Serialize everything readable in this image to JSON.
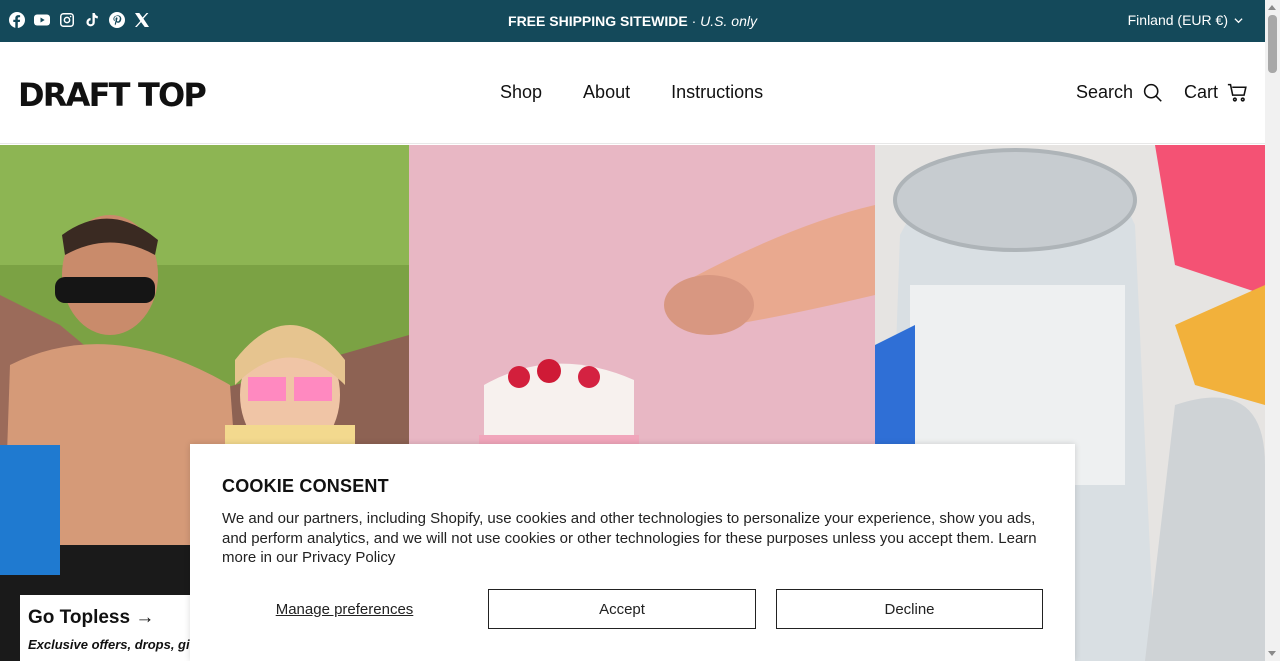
{
  "announcement": {
    "bold": "FREE SHIPPING SITEWIDE",
    "separator": " · ",
    "italic": "U.S. only"
  },
  "socials": [
    "facebook-icon",
    "youtube-icon",
    "instagram-icon",
    "tiktok-icon",
    "pinterest-icon",
    "x-icon"
  ],
  "region": "Finland (EUR €)",
  "header": {
    "logo": "DRAFT TOP",
    "nav": [
      "Shop",
      "About",
      "Instructions"
    ],
    "search": "Search",
    "cart": "Cart"
  },
  "promo": {
    "title": "Go Topless →",
    "subtitle": "Exclusive offers, drops, giv"
  },
  "cookie": {
    "title": "COOKIE CONSENT",
    "text": "We and our partners, including Shopify, use cookies and other technologies to personalize your experience, show you ads, and perform analytics, and we will not use cookies or other technologies for these purposes unless you accept them. Learn more in our Privacy Policy",
    "manage": "Manage preferences",
    "accept": "Accept",
    "decline": "Decline"
  },
  "colors": {
    "announcement_bg": "#14495a",
    "text": "#111111"
  }
}
